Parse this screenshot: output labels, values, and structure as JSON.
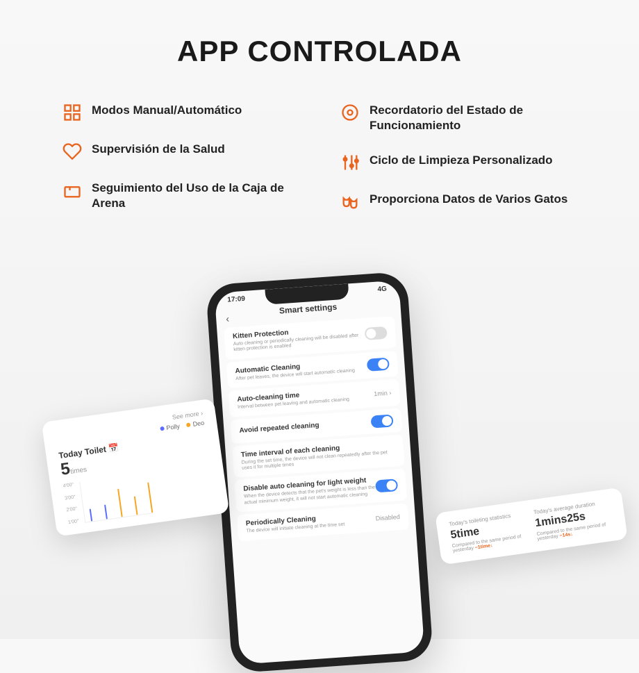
{
  "header": {
    "title": "APP CONTROLADA"
  },
  "features": {
    "left": [
      {
        "icon": "grid",
        "text": "Modos Manual/Automático"
      },
      {
        "icon": "heart",
        "text": "Supervisión de la Salud"
      },
      {
        "icon": "box",
        "text": "Seguimiento del Uso de la Caja de Arena"
      }
    ],
    "right": [
      {
        "icon": "circle",
        "text": "Recordatorio del Estado de Funcionamiento"
      },
      {
        "icon": "sliders",
        "text": "Ciclo de Limpieza Personalizado"
      },
      {
        "icon": "cats",
        "text": "Proporciona Datos de Varios Gatos"
      }
    ]
  },
  "phone": {
    "time": "17:09",
    "signal": "4G",
    "screen_title": "Smart settings",
    "back": "‹",
    "settings": [
      {
        "title": "Kitten Protection",
        "desc": "Auto cleaning or periodically cleaning will be disabled after kitten protection is enabled",
        "toggle": "off"
      },
      {
        "title": "Automatic Cleaning",
        "desc": "After pet leaves, the device will start automatic cleaning",
        "toggle": "on"
      },
      {
        "title": "Auto-cleaning time",
        "desc": "Interval between pet leaving and automatic cleaning",
        "value": "1min ›"
      },
      {
        "title": "Avoid repeated cleaning",
        "desc": "",
        "toggle": "on"
      },
      {
        "title": "Time interval of each cleaning",
        "desc": "During the set time, the device will not clean repeatedly after the pet uses it for multiple times",
        "value": ""
      },
      {
        "title": "Disable auto cleaning for light weight",
        "desc": "When the device detects that the pet's weight is less than the actual minimum weight, it will not start automatic cleaning",
        "toggle": "on"
      },
      {
        "title": "Periodically Cleaning",
        "desc": "The device will initiate cleaning at the time set",
        "value": "Disabled"
      }
    ]
  },
  "card_left": {
    "see_more": "See more ›",
    "legend_a": "Polly",
    "legend_b": "Deo",
    "title": "Today Toilet",
    "title_icon": "📅",
    "value": "5",
    "unit": "times",
    "y_labels": [
      "4'00\"",
      "3'00\"",
      "2'00\"",
      "1'00\""
    ]
  },
  "card_right": {
    "stat_a_label": "Today's toileting statistics",
    "stat_a_value": "5time",
    "stat_a_compare_prefix": "Compared to the same period of yesterday",
    "stat_a_diff": "−1time↓",
    "stat_b_label": "Today's average duration",
    "stat_b_value": "1mins25s",
    "stat_b_compare_prefix": "Compared to the same period of yesterday",
    "stat_b_diff": "−14s↓"
  },
  "colors": {
    "accent": "#e8641f",
    "toggle_on": "#3b82f6",
    "legend_a": "#5b6cff",
    "legend_b": "#f5a623"
  }
}
